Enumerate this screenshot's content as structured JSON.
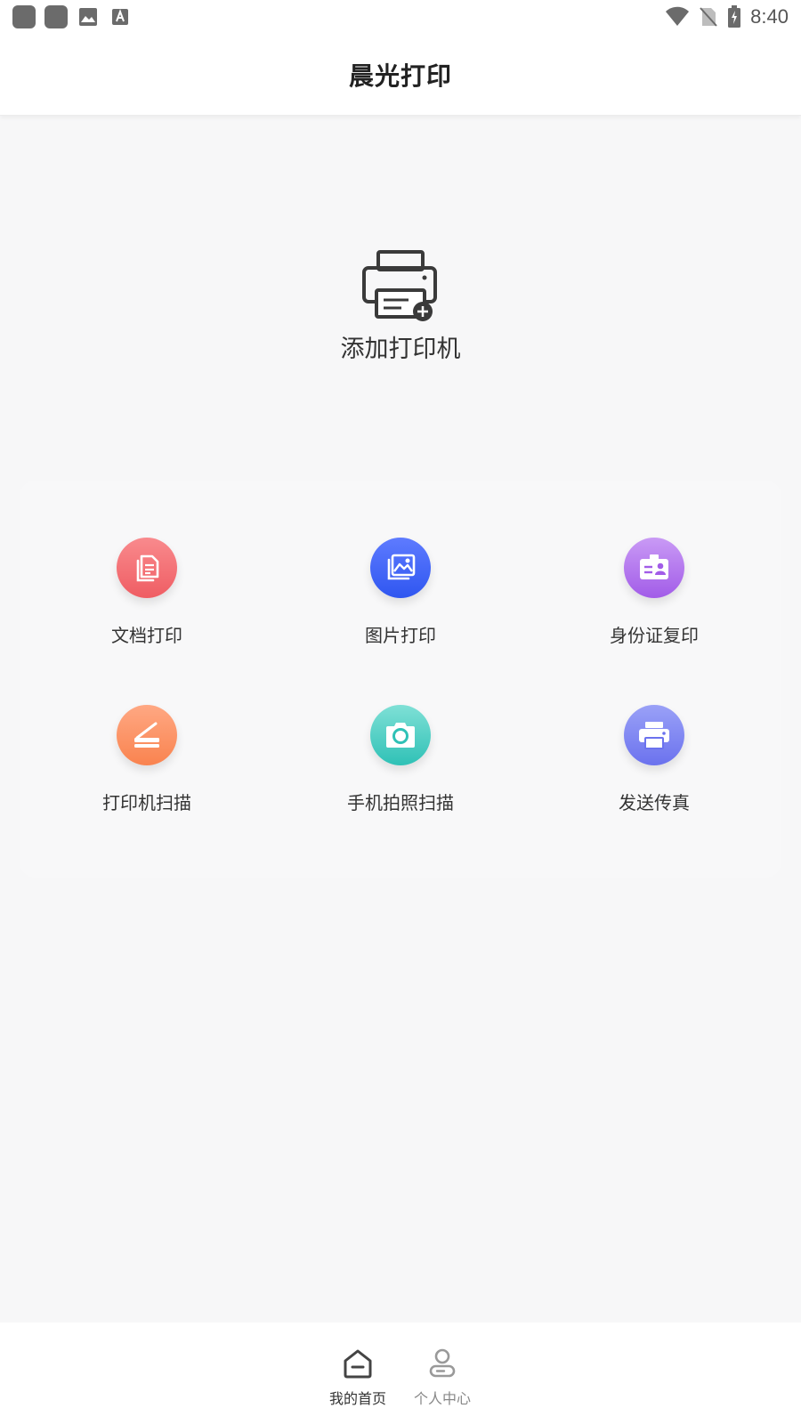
{
  "status_bar": {
    "time": "8:40",
    "left_icons": [
      "app-notification-icon",
      "app-notification-icon",
      "image-icon",
      "text-a-icon"
    ],
    "right_icons": [
      "wifi-icon",
      "no-sim-icon",
      "battery-charging-icon"
    ]
  },
  "header": {
    "title": "晨光打印"
  },
  "add_printer": {
    "label": "添加打印机",
    "icon": "printer-add-icon"
  },
  "functions": [
    {
      "label": "文档打印",
      "icon": "document-icon",
      "color_from": "#f98a8d",
      "color_to": "#ef5d63"
    },
    {
      "label": "图片打印",
      "icon": "picture-icon",
      "color_from": "#5e7bff",
      "color_to": "#2f56f0"
    },
    {
      "label": "身份证复印",
      "icon": "id-card-icon",
      "color_from": "#c99af5",
      "color_to": "#a25ce8"
    },
    {
      "label": "打印机扫描",
      "icon": "scanner-icon",
      "color_from": "#ffa883",
      "color_to": "#f9834f"
    },
    {
      "label": "手机拍照扫描",
      "icon": "camera-icon",
      "color_from": "#7fe0d6",
      "color_to": "#2fc1b6"
    },
    {
      "label": "发送传真",
      "icon": "fax-printer-icon",
      "color_from": "#9aa1f7",
      "color_to": "#6b72ee"
    }
  ],
  "bottom_nav": {
    "items": [
      {
        "label": "我的首页",
        "icon": "home-icon",
        "active": true
      },
      {
        "label": "个人中心",
        "icon": "user-icon",
        "active": false
      }
    ]
  }
}
